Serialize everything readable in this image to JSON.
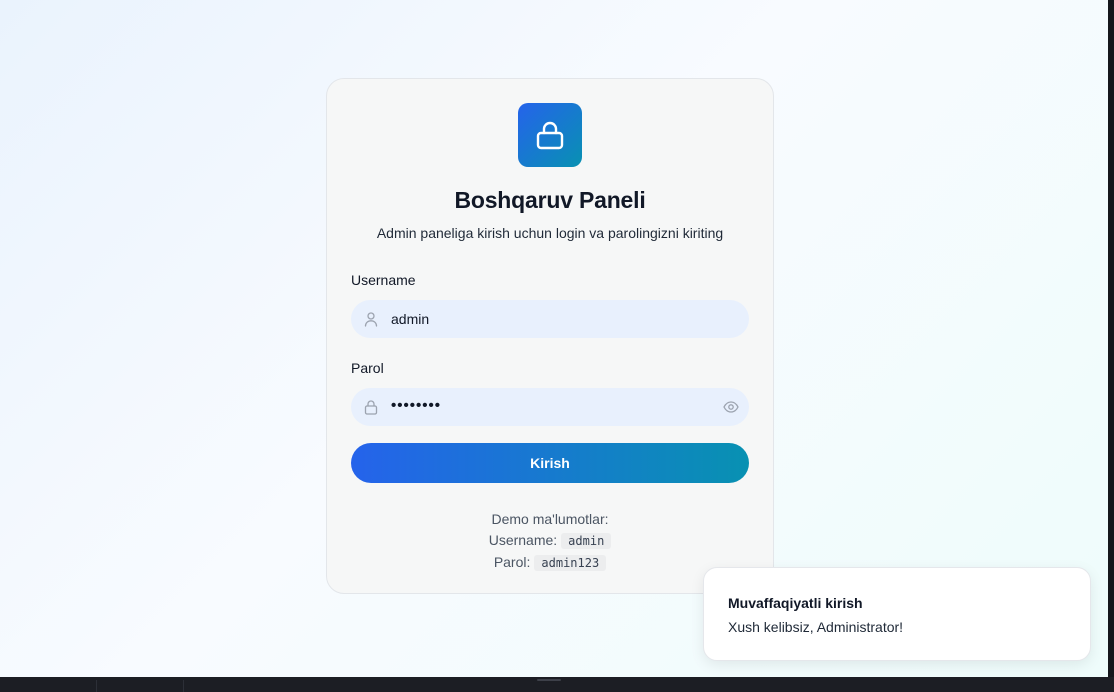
{
  "login": {
    "title": "Boshqaruv Paneli",
    "subtitle": "Admin paneliga kirish uchun login va parolingizni kiriting",
    "username_label": "Username",
    "username_value": "admin",
    "password_label": "Parol",
    "password_value": "••••••••",
    "submit_label": "Kirish",
    "logo_icon": "lock-icon",
    "username_icon": "user-icon",
    "password_icon": "lock-icon",
    "toggle_icon": "eye-icon"
  },
  "demo": {
    "heading": "Demo ma'lumotlar:",
    "username_label": "Username:",
    "username_value": "admin",
    "password_label": "Parol:",
    "password_value": "admin123"
  },
  "toast": {
    "title": "Muvaffaqiyatli kirish",
    "description": "Xush kelibsiz, Administrator!"
  },
  "colors": {
    "accent_start": "#2563eb",
    "accent_end": "#0891b2",
    "input_bg": "#e8f0fd",
    "card_bg": "#f6f7f7"
  }
}
